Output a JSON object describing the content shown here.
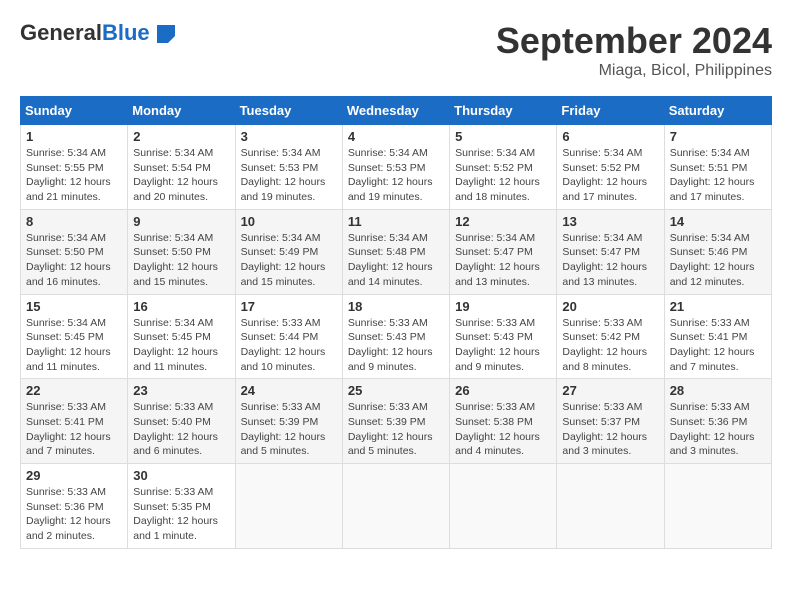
{
  "header": {
    "logo_general": "General",
    "logo_blue": "Blue",
    "month_title": "September 2024",
    "location": "Miaga, Bicol, Philippines"
  },
  "weekdays": [
    "Sunday",
    "Monday",
    "Tuesday",
    "Wednesday",
    "Thursday",
    "Friday",
    "Saturday"
  ],
  "weeks": [
    [
      {
        "day": "1",
        "sunrise": "5:34 AM",
        "sunset": "5:55 PM",
        "daylight": "12 hours and 21 minutes."
      },
      {
        "day": "2",
        "sunrise": "5:34 AM",
        "sunset": "5:54 PM",
        "daylight": "12 hours and 20 minutes."
      },
      {
        "day": "3",
        "sunrise": "5:34 AM",
        "sunset": "5:53 PM",
        "daylight": "12 hours and 19 minutes."
      },
      {
        "day": "4",
        "sunrise": "5:34 AM",
        "sunset": "5:53 PM",
        "daylight": "12 hours and 19 minutes."
      },
      {
        "day": "5",
        "sunrise": "5:34 AM",
        "sunset": "5:52 PM",
        "daylight": "12 hours and 18 minutes."
      },
      {
        "day": "6",
        "sunrise": "5:34 AM",
        "sunset": "5:52 PM",
        "daylight": "12 hours and 17 minutes."
      },
      {
        "day": "7",
        "sunrise": "5:34 AM",
        "sunset": "5:51 PM",
        "daylight": "12 hours and 17 minutes."
      }
    ],
    [
      {
        "day": "8",
        "sunrise": "5:34 AM",
        "sunset": "5:50 PM",
        "daylight": "12 hours and 16 minutes."
      },
      {
        "day": "9",
        "sunrise": "5:34 AM",
        "sunset": "5:50 PM",
        "daylight": "12 hours and 15 minutes."
      },
      {
        "day": "10",
        "sunrise": "5:34 AM",
        "sunset": "5:49 PM",
        "daylight": "12 hours and 15 minutes."
      },
      {
        "day": "11",
        "sunrise": "5:34 AM",
        "sunset": "5:48 PM",
        "daylight": "12 hours and 14 minutes."
      },
      {
        "day": "12",
        "sunrise": "5:34 AM",
        "sunset": "5:47 PM",
        "daylight": "12 hours and 13 minutes."
      },
      {
        "day": "13",
        "sunrise": "5:34 AM",
        "sunset": "5:47 PM",
        "daylight": "12 hours and 13 minutes."
      },
      {
        "day": "14",
        "sunrise": "5:34 AM",
        "sunset": "5:46 PM",
        "daylight": "12 hours and 12 minutes."
      }
    ],
    [
      {
        "day": "15",
        "sunrise": "5:34 AM",
        "sunset": "5:45 PM",
        "daylight": "12 hours and 11 minutes."
      },
      {
        "day": "16",
        "sunrise": "5:34 AM",
        "sunset": "5:45 PM",
        "daylight": "12 hours and 11 minutes."
      },
      {
        "day": "17",
        "sunrise": "5:33 AM",
        "sunset": "5:44 PM",
        "daylight": "12 hours and 10 minutes."
      },
      {
        "day": "18",
        "sunrise": "5:33 AM",
        "sunset": "5:43 PM",
        "daylight": "12 hours and 9 minutes."
      },
      {
        "day": "19",
        "sunrise": "5:33 AM",
        "sunset": "5:43 PM",
        "daylight": "12 hours and 9 minutes."
      },
      {
        "day": "20",
        "sunrise": "5:33 AM",
        "sunset": "5:42 PM",
        "daylight": "12 hours and 8 minutes."
      },
      {
        "day": "21",
        "sunrise": "5:33 AM",
        "sunset": "5:41 PM",
        "daylight": "12 hours and 7 minutes."
      }
    ],
    [
      {
        "day": "22",
        "sunrise": "5:33 AM",
        "sunset": "5:41 PM",
        "daylight": "12 hours and 7 minutes."
      },
      {
        "day": "23",
        "sunrise": "5:33 AM",
        "sunset": "5:40 PM",
        "daylight": "12 hours and 6 minutes."
      },
      {
        "day": "24",
        "sunrise": "5:33 AM",
        "sunset": "5:39 PM",
        "daylight": "12 hours and 5 minutes."
      },
      {
        "day": "25",
        "sunrise": "5:33 AM",
        "sunset": "5:39 PM",
        "daylight": "12 hours and 5 minutes."
      },
      {
        "day": "26",
        "sunrise": "5:33 AM",
        "sunset": "5:38 PM",
        "daylight": "12 hours and 4 minutes."
      },
      {
        "day": "27",
        "sunrise": "5:33 AM",
        "sunset": "5:37 PM",
        "daylight": "12 hours and 3 minutes."
      },
      {
        "day": "28",
        "sunrise": "5:33 AM",
        "sunset": "5:36 PM",
        "daylight": "12 hours and 3 minutes."
      }
    ],
    [
      {
        "day": "29",
        "sunrise": "5:33 AM",
        "sunset": "5:36 PM",
        "daylight": "12 hours and 2 minutes."
      },
      {
        "day": "30",
        "sunrise": "5:33 AM",
        "sunset": "5:35 PM",
        "daylight": "12 hours and 1 minute."
      },
      null,
      null,
      null,
      null,
      null
    ]
  ],
  "labels": {
    "sunrise": "Sunrise:",
    "sunset": "Sunset:",
    "daylight": "Daylight:"
  }
}
